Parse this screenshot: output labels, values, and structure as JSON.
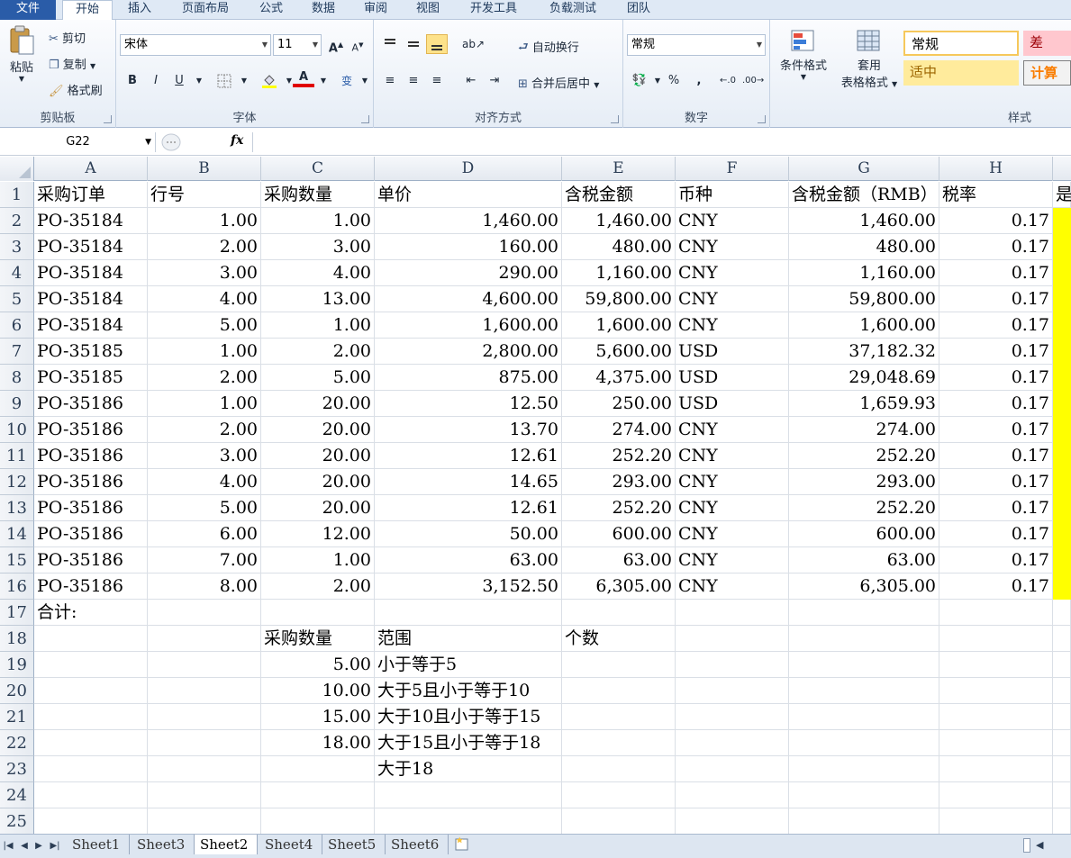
{
  "menu": {
    "tabs": [
      "文件",
      "开始",
      "插入",
      "页面布局",
      "公式",
      "数据",
      "审阅",
      "视图",
      "开发工具",
      "负载测试",
      "团队"
    ]
  },
  "ribbon": {
    "clipboard": {
      "label": "剪贴板",
      "paste": "粘贴",
      "cut": "剪切",
      "copy": "复制",
      "format_painter": "格式刷"
    },
    "font": {
      "label": "字体",
      "font_name": "宋体",
      "font_size": "11",
      "bold": "B",
      "italic": "I",
      "underline": "U",
      "grow": "A",
      "shrink": "A",
      "font_color_letter": "A",
      "wen": "变"
    },
    "alignment": {
      "label": "对齐方式",
      "wrap": "自动换行",
      "merge": "合并后居中"
    },
    "number": {
      "label": "数字",
      "format": "常规",
      "percent": "%",
      "comma": ","
    },
    "styles": {
      "label": "样式",
      "conditional": "条件格式",
      "table_line1": "套用",
      "table_line2": "表格格式",
      "normal": "常规",
      "bad": "差",
      "neutral": "适中",
      "calc": "计算"
    }
  },
  "formula_bar": {
    "name_box": "G22",
    "fx": "fx",
    "formula": ""
  },
  "columns": [
    "A",
    "B",
    "C",
    "D",
    "E",
    "F",
    "G",
    "H"
  ],
  "rows": [
    {
      "n": "1",
      "a": "采购订单",
      "b": "行号",
      "c": "采购数量",
      "d": "单价",
      "e": "含税金额",
      "f": "币种",
      "g": "含税金额（RMB）",
      "h": "税率",
      "i": "是"
    },
    {
      "n": "2",
      "a": "PO-35184",
      "b": "1.00",
      "c": "1.00",
      "d": "1,460.00",
      "e": "1,460.00",
      "f": "CNY",
      "g": "1,460.00",
      "h": "0.17",
      "i": ""
    },
    {
      "n": "3",
      "a": "PO-35184",
      "b": "2.00",
      "c": "3.00",
      "d": "160.00",
      "e": "480.00",
      "f": "CNY",
      "g": "480.00",
      "h": "0.17",
      "i": ""
    },
    {
      "n": "4",
      "a": "PO-35184",
      "b": "3.00",
      "c": "4.00",
      "d": "290.00",
      "e": "1,160.00",
      "f": "CNY",
      "g": "1,160.00",
      "h": "0.17",
      "i": ""
    },
    {
      "n": "5",
      "a": "PO-35184",
      "b": "4.00",
      "c": "13.00",
      "d": "4,600.00",
      "e": "59,800.00",
      "f": "CNY",
      "g": "59,800.00",
      "h": "0.17",
      "i": ""
    },
    {
      "n": "6",
      "a": "PO-35184",
      "b": "5.00",
      "c": "1.00",
      "d": "1,600.00",
      "e": "1,600.00",
      "f": "CNY",
      "g": "1,600.00",
      "h": "0.17",
      "i": ""
    },
    {
      "n": "7",
      "a": "PO-35185",
      "b": "1.00",
      "c": "2.00",
      "d": "2,800.00",
      "e": "5,600.00",
      "f": "USD",
      "g": "37,182.32",
      "h": "0.17",
      "i": ""
    },
    {
      "n": "8",
      "a": "PO-35185",
      "b": "2.00",
      "c": "5.00",
      "d": "875.00",
      "e": "4,375.00",
      "f": "USD",
      "g": "29,048.69",
      "h": "0.17",
      "i": ""
    },
    {
      "n": "9",
      "a": "PO-35186",
      "b": "1.00",
      "c": "20.00",
      "d": "12.50",
      "e": "250.00",
      "f": "USD",
      "g": "1,659.93",
      "h": "0.17",
      "i": ""
    },
    {
      "n": "10",
      "a": "PO-35186",
      "b": "2.00",
      "c": "20.00",
      "d": "13.70",
      "e": "274.00",
      "f": "CNY",
      "g": "274.00",
      "h": "0.17",
      "i": ""
    },
    {
      "n": "11",
      "a": "PO-35186",
      "b": "3.00",
      "c": "20.00",
      "d": "12.61",
      "e": "252.20",
      "f": "CNY",
      "g": "252.20",
      "h": "0.17",
      "i": ""
    },
    {
      "n": "12",
      "a": "PO-35186",
      "b": "4.00",
      "c": "20.00",
      "d": "14.65",
      "e": "293.00",
      "f": "CNY",
      "g": "293.00",
      "h": "0.17",
      "i": ""
    },
    {
      "n": "13",
      "a": "PO-35186",
      "b": "5.00",
      "c": "20.00",
      "d": "12.61",
      "e": "252.20",
      "f": "CNY",
      "g": "252.20",
      "h": "0.17",
      "i": ""
    },
    {
      "n": "14",
      "a": "PO-35186",
      "b": "6.00",
      "c": "12.00",
      "d": "50.00",
      "e": "600.00",
      "f": "CNY",
      "g": "600.00",
      "h": "0.17",
      "i": ""
    },
    {
      "n": "15",
      "a": "PO-35186",
      "b": "7.00",
      "c": "1.00",
      "d": "63.00",
      "e": "63.00",
      "f": "CNY",
      "g": "63.00",
      "h": "0.17",
      "i": ""
    },
    {
      "n": "16",
      "a": "PO-35186",
      "b": "8.00",
      "c": "2.00",
      "d": "3,152.50",
      "e": "6,305.00",
      "f": "CNY",
      "g": "6,305.00",
      "h": "0.17",
      "i": ""
    },
    {
      "n": "17",
      "a": "合计:",
      "b": "",
      "c": "",
      "d": "",
      "e": "",
      "f": "",
      "g": "",
      "h": "",
      "i": ""
    },
    {
      "n": "18",
      "a": "",
      "b": "",
      "c": "采购数量",
      "d": "范围",
      "e": "个数",
      "f": "",
      "g": "",
      "h": "",
      "i": ""
    },
    {
      "n": "19",
      "a": "",
      "b": "",
      "c": "5.00",
      "d": "小于等于5",
      "e": "",
      "f": "",
      "g": "",
      "h": "",
      "i": ""
    },
    {
      "n": "20",
      "a": "",
      "b": "",
      "c": "10.00",
      "d": "大于5且小于等于10",
      "e": "",
      "f": "",
      "g": "",
      "h": "",
      "i": ""
    },
    {
      "n": "21",
      "a": "",
      "b": "",
      "c": "15.00",
      "d": "大于10且小于等于15",
      "e": "",
      "f": "",
      "g": "",
      "h": "",
      "i": ""
    },
    {
      "n": "22",
      "a": "",
      "b": "",
      "c": "18.00",
      "d": "大于15且小于等于18",
      "e": "",
      "f": "",
      "g": "",
      "h": "",
      "i": ""
    },
    {
      "n": "23",
      "a": "",
      "b": "",
      "c": "",
      "d": "大于18",
      "e": "",
      "f": "",
      "g": "",
      "h": "",
      "i": ""
    },
    {
      "n": "24",
      "a": "",
      "b": "",
      "c": "",
      "d": "",
      "e": "",
      "f": "",
      "g": "",
      "h": "",
      "i": ""
    },
    {
      "n": "25",
      "a": "",
      "b": "",
      "c": "",
      "d": "",
      "e": "",
      "f": "",
      "g": "",
      "h": "",
      "i": ""
    }
  ],
  "sheets": [
    "Sheet1",
    "Sheet3",
    "Sheet2",
    "Sheet4",
    "Sheet5",
    "Sheet6"
  ],
  "active_sheet": "Sheet2",
  "colors": {
    "accent": "#2a5ca8",
    "highlight": "#ffff00",
    "font_red": "#e00000",
    "style_bad_bg": "#ffc7ce",
    "style_bad_fg": "#9c0006",
    "style_neutral_bg": "#ffeb9c",
    "style_neutral_fg": "#9c6500",
    "style_calc_fg": "#fa7d00"
  }
}
